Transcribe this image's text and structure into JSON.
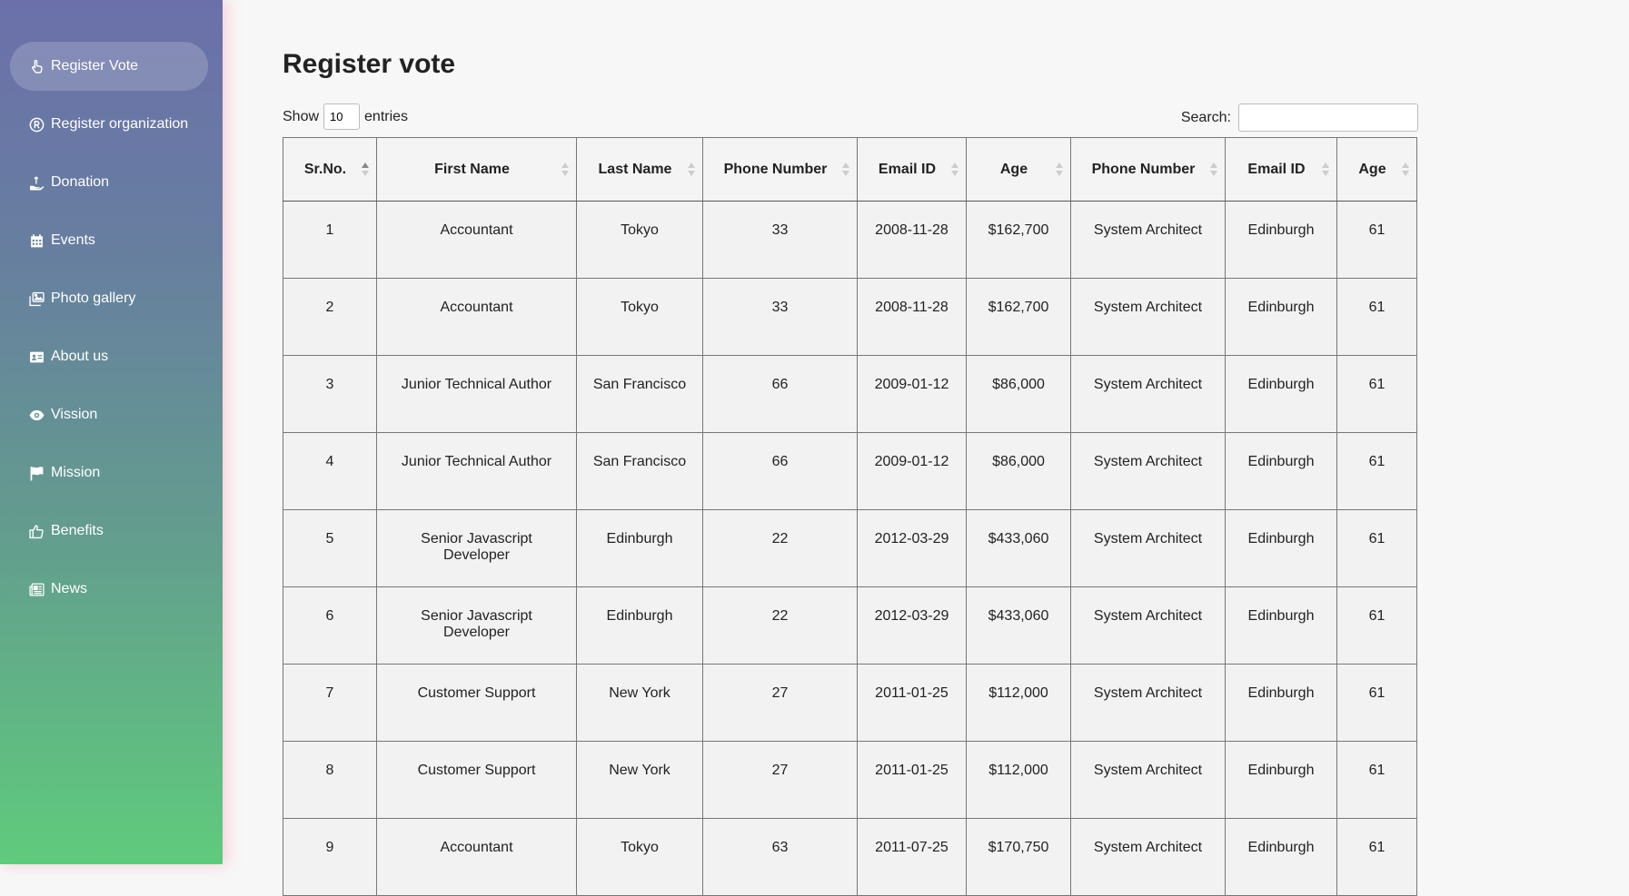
{
  "sidebar": {
    "items": [
      {
        "label": "Register Vote",
        "icon": "hand-pointer-icon",
        "active": true
      },
      {
        "label": "Register organization",
        "icon": "registered-icon",
        "active": false
      },
      {
        "label": "Donation",
        "icon": "hand-holding-heart-icon",
        "active": false
      },
      {
        "label": "Events",
        "icon": "calendar-icon",
        "active": false
      },
      {
        "label": "Photo gallery",
        "icon": "images-icon",
        "active": false
      },
      {
        "label": "About us",
        "icon": "id-card-icon",
        "active": false
      },
      {
        "label": "Vission",
        "icon": "eye-icon",
        "active": false
      },
      {
        "label": "Mission",
        "icon": "flag-icon",
        "active": false
      },
      {
        "label": "Benefits",
        "icon": "thumbs-up-icon",
        "active": false
      },
      {
        "label": "News",
        "icon": "newspaper-icon",
        "active": false
      }
    ]
  },
  "page": {
    "title": "Register vote"
  },
  "controls": {
    "show_label": "Show",
    "entries_value": "10",
    "entries_label": "entries",
    "search_label": "Search:",
    "search_value": ""
  },
  "table": {
    "columns": [
      "Sr.No.",
      "First Name",
      "Last Name",
      "Phone Number",
      "Email ID",
      "Age",
      "Phone Number",
      "Email ID",
      "Age"
    ],
    "sorted_column": 0,
    "rows": [
      [
        "1",
        "Accountant",
        "Tokyo",
        "33",
        "2008-11-28",
        "$162,700",
        "System Architect",
        "Edinburgh",
        "61"
      ],
      [
        "2",
        "Accountant",
        "Tokyo",
        "33",
        "2008-11-28",
        "$162,700",
        "System Architect",
        "Edinburgh",
        "61"
      ],
      [
        "3",
        "Junior Technical Author",
        "San Francisco",
        "66",
        "2009-01-12",
        "$86,000",
        "System Architect",
        "Edinburgh",
        "61"
      ],
      [
        "4",
        "Junior Technical Author",
        "San Francisco",
        "66",
        "2009-01-12",
        "$86,000",
        "System Architect",
        "Edinburgh",
        "61"
      ],
      [
        "5",
        "Senior Javascript Developer",
        "Edinburgh",
        "22",
        "2012-03-29",
        "$433,060",
        "System Architect",
        "Edinburgh",
        "61"
      ],
      [
        "6",
        "Senior Javascript Developer",
        "Edinburgh",
        "22",
        "2012-03-29",
        "$433,060",
        "System Architect",
        "Edinburgh",
        "61"
      ],
      [
        "7",
        "Customer Support",
        "New York",
        "27",
        "2011-01-25",
        "$112,000",
        "System Architect",
        "Edinburgh",
        "61"
      ],
      [
        "8",
        "Customer Support",
        "New York",
        "27",
        "2011-01-25",
        "$112,000",
        "System Architect",
        "Edinburgh",
        "61"
      ],
      [
        "9",
        "Accountant",
        "Tokyo",
        "63",
        "2011-07-25",
        "$170,750",
        "System Architect",
        "Edinburgh",
        "61"
      ]
    ]
  }
}
